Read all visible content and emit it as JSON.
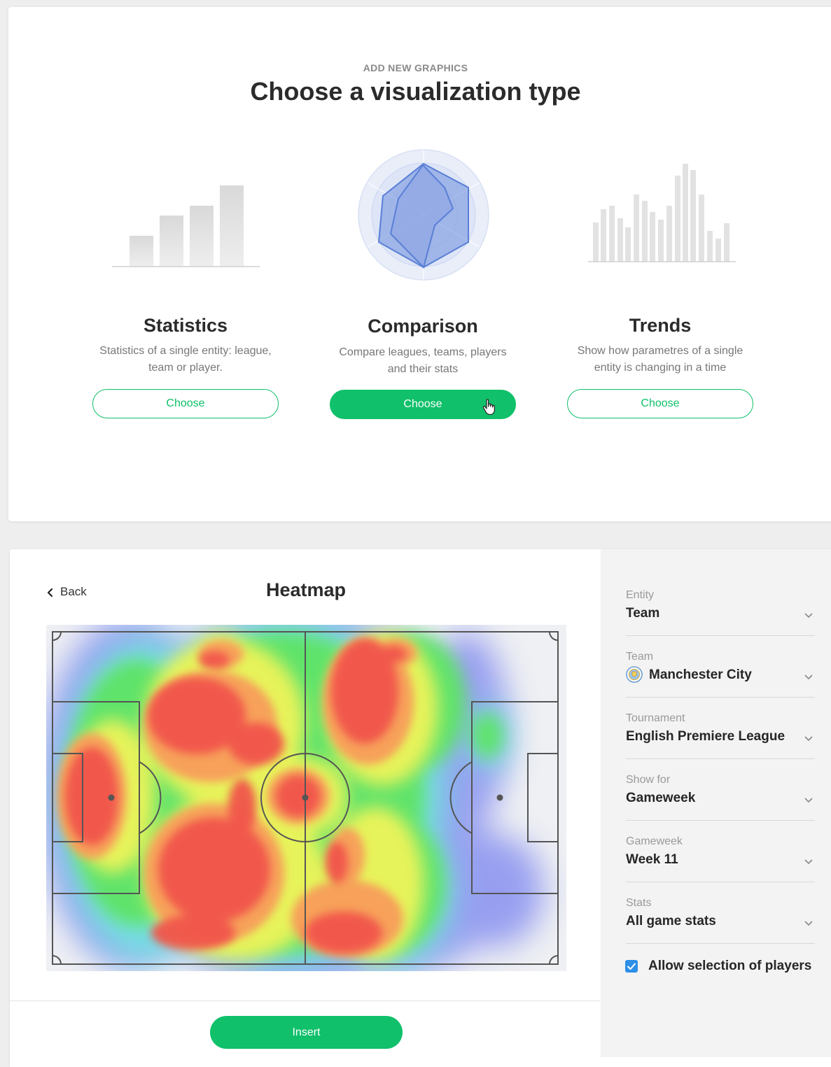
{
  "picker": {
    "eyebrow": "ADD NEW GRAPHICS",
    "title": "Choose a visualization type",
    "options": [
      {
        "title": "Statistics",
        "desc_line1": "Statistics of a single entity: league,",
        "desc_line2": "team or player.",
        "button": "Choose",
        "icon": "bar-chart-icon"
      },
      {
        "title": "Comparison",
        "desc_line1": "Compare leagues, teams, players",
        "desc_line2": "and their stats",
        "button": "Choose",
        "icon": "radar-chart-icon"
      },
      {
        "title": "Trends",
        "desc_line1": "Show how parametres of a single",
        "desc_line2": "entity is changing in a time",
        "button": "Choose",
        "icon": "trend-bars-icon"
      }
    ],
    "selected_option": "Comparison"
  },
  "editor": {
    "back_label": "Back",
    "title": "Heatmap",
    "insert_label": "Insert"
  },
  "settings": {
    "fields": [
      {
        "label": "Entity",
        "value": "Team"
      },
      {
        "label": "Team",
        "value": "Manchester City",
        "icon": "team-crest-icon"
      },
      {
        "label": "Tournament",
        "value": "English Premiere League"
      },
      {
        "label": "Show for",
        "value": "Gameweek"
      },
      {
        "label": "Gameweek",
        "value": "Week 11"
      },
      {
        "label": "Stats",
        "value": "All game stats"
      }
    ],
    "allow_selection": {
      "label": "Allow selection of players",
      "checked": true
    }
  },
  "colors": {
    "accent_green": "#10c06a",
    "checkbox_blue": "#2d8fe8",
    "radar_blue": "#5a7fd6"
  }
}
